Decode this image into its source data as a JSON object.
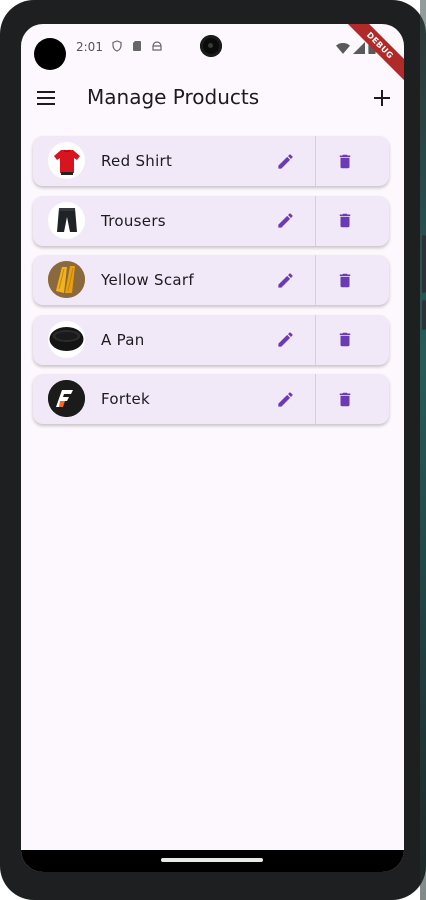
{
  "status_bar": {
    "time": "2:01",
    "debug_label": "DEBUG"
  },
  "app_bar": {
    "title": "Manage Products",
    "menu_icon": "menu-icon",
    "add_icon": "add-icon"
  },
  "colors": {
    "accent": "#6b3bb5",
    "card_background": "#f1e9f7",
    "screen_background": "#fdf8fd",
    "debug_ribbon": "#b02a2a"
  },
  "products": [
    {
      "name": "Red Shirt",
      "thumbnail": "red-shirt-thumbnail"
    },
    {
      "name": "Trousers",
      "thumbnail": "trousers-thumbnail"
    },
    {
      "name": "Yellow Scarf",
      "thumbnail": "yellow-scarf-thumbnail"
    },
    {
      "name": "A Pan",
      "thumbnail": "pan-thumbnail"
    },
    {
      "name": "Fortek",
      "thumbnail": "fortek-logo-thumbnail"
    }
  ]
}
